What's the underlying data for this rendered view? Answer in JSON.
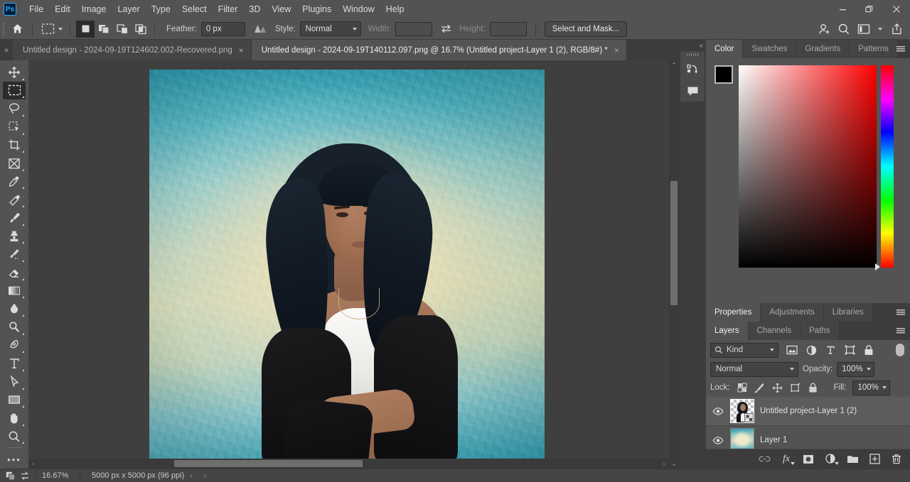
{
  "app": {
    "name": "Adobe Photoshop",
    "logo_text": "Ps"
  },
  "menubar": {
    "items": [
      {
        "label": "File"
      },
      {
        "label": "Edit"
      },
      {
        "label": "Image"
      },
      {
        "label": "Layer"
      },
      {
        "label": "Type"
      },
      {
        "label": "Select"
      },
      {
        "label": "Filter"
      },
      {
        "label": "3D"
      },
      {
        "label": "View"
      },
      {
        "label": "Plugins"
      },
      {
        "label": "Window"
      },
      {
        "label": "Help"
      }
    ],
    "window_controls": [
      "minimize",
      "restore",
      "close"
    ]
  },
  "options_bar": {
    "home_icon": "home-icon",
    "tool_icon": "rectangular-marquee-icon",
    "selection_modes": [
      "new-selection",
      "add-to-selection",
      "subtract-from-selection",
      "intersect-with-selection"
    ],
    "selection_mode_active": 0,
    "feather_label": "Feather:",
    "feather_value": "0 px",
    "antialias_icon": "anti-alias-icon",
    "style_label": "Style:",
    "style_value": "Normal",
    "width_label": "Width:",
    "width_value": "",
    "swap_icon": "swap-width-height-icon",
    "height_label": "Height:",
    "height_value": "",
    "select_and_mask_label": "Select and Mask...",
    "right_icons": [
      "add-collaborator-icon",
      "search-icon",
      "workspace-icon",
      "chevron-down-icon",
      "share-icon"
    ]
  },
  "tabs": {
    "collapse_icon": "expand-panel-icon",
    "items": [
      {
        "title": "Untitled design - 2024-09-19T124602.002-Recovered.png",
        "active": false,
        "close": "×"
      },
      {
        "title": "Untitled design - 2024-09-19T140112.097.png @ 16.7% (Untitled project-Layer 1 (2), RGB/8#) *",
        "active": true,
        "close": "×"
      }
    ]
  },
  "toolbar": {
    "tools": [
      {
        "name": "move-tool",
        "active": false
      },
      {
        "name": "rectangular-marquee-tool",
        "active": true
      },
      {
        "name": "lasso-tool",
        "active": false
      },
      {
        "name": "object-selection-tool",
        "active": false
      },
      {
        "name": "crop-tool",
        "active": false
      },
      {
        "name": "frame-tool",
        "active": false
      },
      {
        "name": "eyedropper-tool",
        "active": false
      },
      {
        "name": "spot-healing-brush-tool",
        "active": false
      },
      {
        "name": "brush-tool",
        "active": false
      },
      {
        "name": "clone-stamp-tool",
        "active": false
      },
      {
        "name": "history-brush-tool",
        "active": false
      },
      {
        "name": "eraser-tool",
        "active": false
      },
      {
        "name": "gradient-tool",
        "active": false
      },
      {
        "name": "blur-tool",
        "active": false
      },
      {
        "name": "dodge-tool",
        "active": false
      },
      {
        "name": "pen-tool",
        "active": false
      },
      {
        "name": "type-tool",
        "active": false
      },
      {
        "name": "path-selection-tool",
        "active": false
      },
      {
        "name": "rectangle-tool",
        "active": false
      },
      {
        "name": "hand-tool",
        "active": false
      },
      {
        "name": "zoom-tool",
        "active": false
      }
    ],
    "more_tools": "•••"
  },
  "canvas": {
    "document_title": "Untitled design - 2024-09-19T140112.097.png",
    "artwork_description": "Portrait of a young woman with long dark wavy hair wearing a white tank top and black off-shoulder cardigan, arms crossed, on a teal and cream textured painted background",
    "vertical_scrollbar": "vertical-scrollbar",
    "horizontal_scrollbar": "horizontal-scrollbar",
    "scroll_up": "⌃",
    "scroll_down": "⌄",
    "scroll_left": "‹",
    "scroll_right": "›"
  },
  "status_bar": {
    "zoom_level": "16.67%",
    "document_size": "5000 px x 5000 px (96 ppi)",
    "expand_arrow": "›",
    "left_arrow": "‹",
    "icons": [
      "arrange-documents-icon",
      "rotate-view-icon"
    ]
  },
  "mini_dock": {
    "collapse_icon": "«",
    "buttons": [
      "history-icon",
      "comments-icon"
    ]
  },
  "color_panel": {
    "tabs": [
      {
        "label": "Color",
        "active": true
      },
      {
        "label": "Swatches",
        "active": false
      },
      {
        "label": "Gradients",
        "active": false
      },
      {
        "label": "Patterns",
        "active": false
      }
    ],
    "menu_icon": "panel-menu-icon",
    "foreground_color": "#000000",
    "background_color": "#ffffff",
    "picker_base_color": "#ff0000"
  },
  "properties_panel": {
    "tabs": [
      {
        "label": "Properties",
        "active": true
      },
      {
        "label": "Adjustments",
        "active": false
      },
      {
        "label": "Libraries",
        "active": false
      }
    ],
    "menu_icon": "panel-menu-icon"
  },
  "layers_panel": {
    "tabs": [
      {
        "label": "Layers",
        "active": true
      },
      {
        "label": "Channels",
        "active": false
      },
      {
        "label": "Paths",
        "active": false
      }
    ],
    "menu_icon": "panel-menu-icon",
    "filter": {
      "search_icon": "search-icon",
      "kind_label": "Kind",
      "filter_icons": [
        "pixel-layer-filter-icon",
        "adjustment-layer-filter-icon",
        "type-layer-filter-icon",
        "shape-layer-filter-icon",
        "smart-object-filter-icon"
      ],
      "toggle": "filter-toggle"
    },
    "blend_mode": "Normal",
    "opacity_label": "Opacity:",
    "opacity_value": "100%",
    "lock_label": "Lock:",
    "lock_icons": [
      "lock-transparent-pixels-icon",
      "lock-image-pixels-icon",
      "lock-position-icon",
      "lock-artboard-nesting-icon",
      "lock-all-icon"
    ],
    "fill_label": "Fill:",
    "fill_value": "100%",
    "layers": [
      {
        "name": "Untitled project-Layer 1 (2)",
        "visible": true,
        "selected": true,
        "thumb": "transparent-portrait",
        "smart_object": true
      },
      {
        "name": "Layer 1",
        "visible": true,
        "selected": false,
        "thumb": "teal-texture",
        "smart_object": false
      }
    ],
    "footer_icons": [
      "link-layers-icon",
      "layer-style-fx-icon",
      "add-layer-mask-icon",
      "new-adjustment-layer-icon",
      "new-group-icon",
      "new-layer-icon",
      "delete-layer-icon"
    ],
    "fx_label": "fx"
  }
}
